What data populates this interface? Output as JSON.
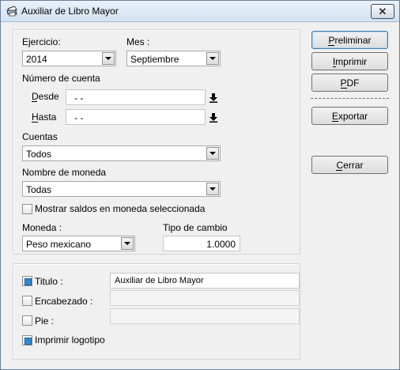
{
  "window": {
    "title": "Auxiliar de Libro Mayor"
  },
  "ejercicio": {
    "label": "Ejercicio:",
    "value": "2014"
  },
  "mes": {
    "label": "Mes :",
    "value": "Septiembre"
  },
  "cuenta": {
    "label": "Número de cuenta",
    "desde_label": "Desde",
    "desde_value": "- -",
    "hasta_label": "Hasta",
    "hasta_value": "- -"
  },
  "cuentas": {
    "label": "Cuentas",
    "value": "Todos"
  },
  "nombre_moneda": {
    "label": "Nombre de moneda",
    "value": "Todas"
  },
  "mostrar_saldos": {
    "label": "Mostrar saldos en moneda seleccionada",
    "checked": false
  },
  "moneda": {
    "label": "Moneda :",
    "value": "Peso mexicano"
  },
  "tipo_cambio": {
    "label": "Tipo de cambio",
    "value": "1.0000"
  },
  "titulo": {
    "label": "Titulo :",
    "checked": true,
    "value": "Auxiliar de Libro Mayor"
  },
  "encabezado": {
    "label": "Encabezado :",
    "checked": false,
    "value": ""
  },
  "pie": {
    "label": "Pie :",
    "checked": false,
    "value": ""
  },
  "imprimir_logotipo": {
    "label": "Imprimir logotipo",
    "checked": true
  },
  "buttons": {
    "preliminar": "Preliminar",
    "imprimir": "Imprimir",
    "pdf": "PDF",
    "exportar": "Exportar",
    "cerrar": "Cerrar"
  },
  "icons": {
    "app": "printer-icon",
    "close": "close-icon",
    "lookup": "down-arrow-icon",
    "dropdown": "chevron-down-icon"
  },
  "colors": {
    "checkbox_checked": "#2e8bd6",
    "window_bg": "#f0f0f0",
    "titlebar": "#d4e1f2"
  }
}
